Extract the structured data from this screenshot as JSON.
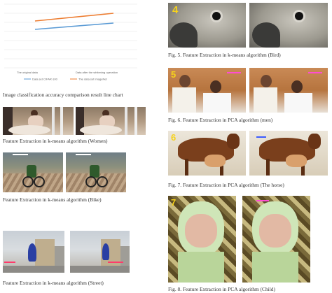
{
  "chart": {
    "caption": "Image classification accuracy comparison result line chart",
    "xticks": [
      "The original data",
      "Data after the whitening operation"
    ],
    "legend": [
      "Data set CIFAR-100",
      "The data set ImageNet"
    ],
    "colors": {
      "series1": "#5b9bd5",
      "series2": "#ed7d31"
    }
  },
  "left_captions": {
    "women": "Feature Extraction in k-means algorithm (Women)",
    "bike": "Feature Extraction in k-means algorithm (Bike)",
    "street": "Feature Extraction in k-means algorithm (Street)"
  },
  "right_captions": {
    "bird": "Fig. 5.   Feature Extraction in k-means algorithm (Bird)",
    "men": "Fig. 6.   Feature Extraction in PCA algorithm (men)",
    "horse": "Fig. 7.   Feature Extraction in PCA algorithm (The horse)",
    "child": "Fig. 8.   Feature Extraction in PCA algorithm (Child)"
  },
  "panel_numbers": {
    "bird": "4",
    "men": "5",
    "horse": "6",
    "child": "7"
  }
}
